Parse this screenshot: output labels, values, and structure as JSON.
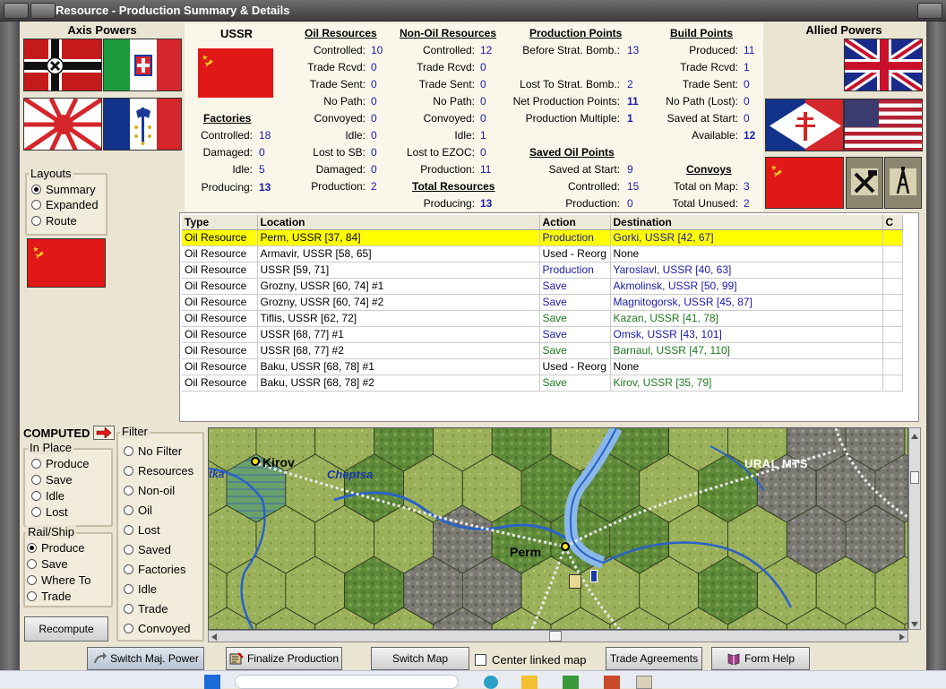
{
  "window": {
    "title": "Resource - Production Summary & Details"
  },
  "axis": {
    "title": "Axis Powers"
  },
  "allied": {
    "title": "Allied Powers"
  },
  "power": {
    "name": "USSR"
  },
  "factories": {
    "header": "Factories",
    "rows": [
      {
        "label": "Controlled:",
        "value": "18"
      },
      {
        "label": "Damaged:",
        "value": "0"
      },
      {
        "label": "Idle:",
        "value": "5"
      },
      {
        "label": "Producing:",
        "value": "13"
      }
    ]
  },
  "oil": {
    "header": "Oil Resources",
    "rows": [
      {
        "label": "Controlled:",
        "value": "10"
      },
      {
        "label": "Trade Rcvd:",
        "value": "0"
      },
      {
        "label": "Trade Sent:",
        "value": "0"
      },
      {
        "label": "No Path:",
        "value": "0"
      },
      {
        "label": "Convoyed:",
        "value": "0"
      },
      {
        "label": "Idle:",
        "value": "0"
      },
      {
        "label": "Lost to SB:",
        "value": "0"
      },
      {
        "label": "Damaged:",
        "value": "0"
      },
      {
        "label": "Production:",
        "value": "2"
      }
    ]
  },
  "nonoil": {
    "header": "Non-Oil Resources",
    "rows": [
      {
        "label": "Controlled:",
        "value": "12"
      },
      {
        "label": "Trade Rcvd:",
        "value": "0"
      },
      {
        "label": "Trade Sent:",
        "value": "0"
      },
      {
        "label": "No Path:",
        "value": "0"
      },
      {
        "label": "Convoyed:",
        "value": "0"
      },
      {
        "label": "Idle:",
        "value": "1"
      },
      {
        "label": "Lost to EZOC:",
        "value": "0"
      },
      {
        "label": "Production:",
        "value": "11"
      }
    ]
  },
  "total": {
    "header": "Total Resources",
    "label": "Producing:",
    "value": "13"
  },
  "pp": {
    "header": "Production Points",
    "rows": [
      {
        "label": "Before Strat. Bomb.:",
        "value": "13"
      },
      {
        "label": "Lost To Strat. Bomb.:",
        "value": "2"
      },
      {
        "label": "Net Production Points:",
        "value": "11"
      },
      {
        "label": "Production Multiple:",
        "value": "1"
      }
    ]
  },
  "saved": {
    "header": "Saved Oil Points",
    "rows": [
      {
        "label": "Saved at Start:",
        "value": "9"
      },
      {
        "label": "Controlled:",
        "value": "15"
      },
      {
        "label": "Production:",
        "value": "0"
      }
    ]
  },
  "bp": {
    "header": "Build Points",
    "rows": [
      {
        "label": "Produced:",
        "value": "11"
      },
      {
        "label": "Trade Rcvd:",
        "value": "1"
      },
      {
        "label": "Trade Sent:",
        "value": "0"
      },
      {
        "label": "No Path (Lost):",
        "value": "0"
      },
      {
        "label": "Saved at Start:",
        "value": "0"
      },
      {
        "label": "Available:",
        "value": "12"
      }
    ]
  },
  "convoys": {
    "header": "Convoys",
    "rows": [
      {
        "label": "Total on Map:",
        "value": "3"
      },
      {
        "label": "Total Unused:",
        "value": "2"
      }
    ]
  },
  "layouts": {
    "title": "Layouts",
    "options": [
      "Summary",
      "Expanded",
      "Route"
    ],
    "selected": "Summary"
  },
  "computed": {
    "label": "COMPUTED"
  },
  "inplace": {
    "title": "In Place",
    "options": [
      "Produce",
      "Save",
      "Idle",
      "Lost"
    ]
  },
  "railship": {
    "title": "Rail/Ship",
    "options": [
      "Produce",
      "Save",
      "Where To",
      "Trade"
    ],
    "selected": "Produce"
  },
  "filter": {
    "title": "Filter",
    "options": [
      "No Filter",
      "Resources",
      "Non-oil",
      "Oil",
      "Lost",
      "Saved",
      "Factories",
      "Idle",
      "Trade",
      "Convoyed"
    ]
  },
  "buttons": {
    "recompute": "Recompute",
    "switch_power": "Switch Maj. Power",
    "finalize": "Finalize Production",
    "switch_map": "Switch Map",
    "center_map": "Center linked map",
    "trade": "Trade Agreements",
    "help": "Form Help"
  },
  "table": {
    "columns": [
      "Type",
      "Location",
      "Action",
      "Destination",
      "C"
    ],
    "rows": [
      {
        "type": "Oil Resource",
        "location": "Perm, USSR [37, 84]",
        "action": "Production",
        "destination": "Gorki, USSR [42, 67]",
        "color": "blue",
        "selected": true
      },
      {
        "type": "Oil Resource",
        "location": "Armavir, USSR [58, 65]",
        "action": "Used - Reorg",
        "destination": "None",
        "color": "black",
        "selected": false
      },
      {
        "type": "Oil Resource",
        "location": "USSR [59, 71]",
        "action": "Production",
        "destination": "Yaroslavl, USSR [40, 63]",
        "color": "blue",
        "selected": false
      },
      {
        "type": "Oil Resource",
        "location": "Grozny, USSR [60, 74] #1",
        "action": "Save",
        "destination": "Akmolinsk, USSR [50, 99]",
        "color": "blue",
        "selected": false
      },
      {
        "type": "Oil Resource",
        "location": "Grozny, USSR [60, 74] #2",
        "action": "Save",
        "destination": "Magnitogorsk, USSR [45, 87]",
        "color": "blue",
        "selected": false
      },
      {
        "type": "Oil Resource",
        "location": "Tiflis, USSR [62, 72]",
        "action": "Save",
        "destination": "Kazan, USSR [41, 78]",
        "color": "green",
        "selected": false
      },
      {
        "type": "Oil Resource",
        "location": "USSR [68, 77] #1",
        "action": "Save",
        "destination": "Omsk, USSR [43, 101]",
        "color": "blue",
        "selected": false
      },
      {
        "type": "Oil Resource",
        "location": "USSR [68, 77] #2",
        "action": "Save",
        "destination": "Barnaul, USSR [47, 110]",
        "color": "green",
        "selected": false
      },
      {
        "type": "Oil Resource",
        "location": "Baku, USSR [68, 78] #1",
        "action": "Used - Reorg",
        "destination": "None",
        "color": "black",
        "selected": false
      },
      {
        "type": "Oil Resource",
        "location": "Baku, USSR [68, 78] #2",
        "action": "Save",
        "destination": "Kirov, USSR [35, 79]",
        "color": "green",
        "selected": false
      }
    ]
  },
  "map": {
    "labels": {
      "kirov": "Kirov",
      "perm": "Perm",
      "cheptsa": "Cheptsa",
      "vyatka": "tka",
      "ural": "URAL MTS"
    }
  }
}
